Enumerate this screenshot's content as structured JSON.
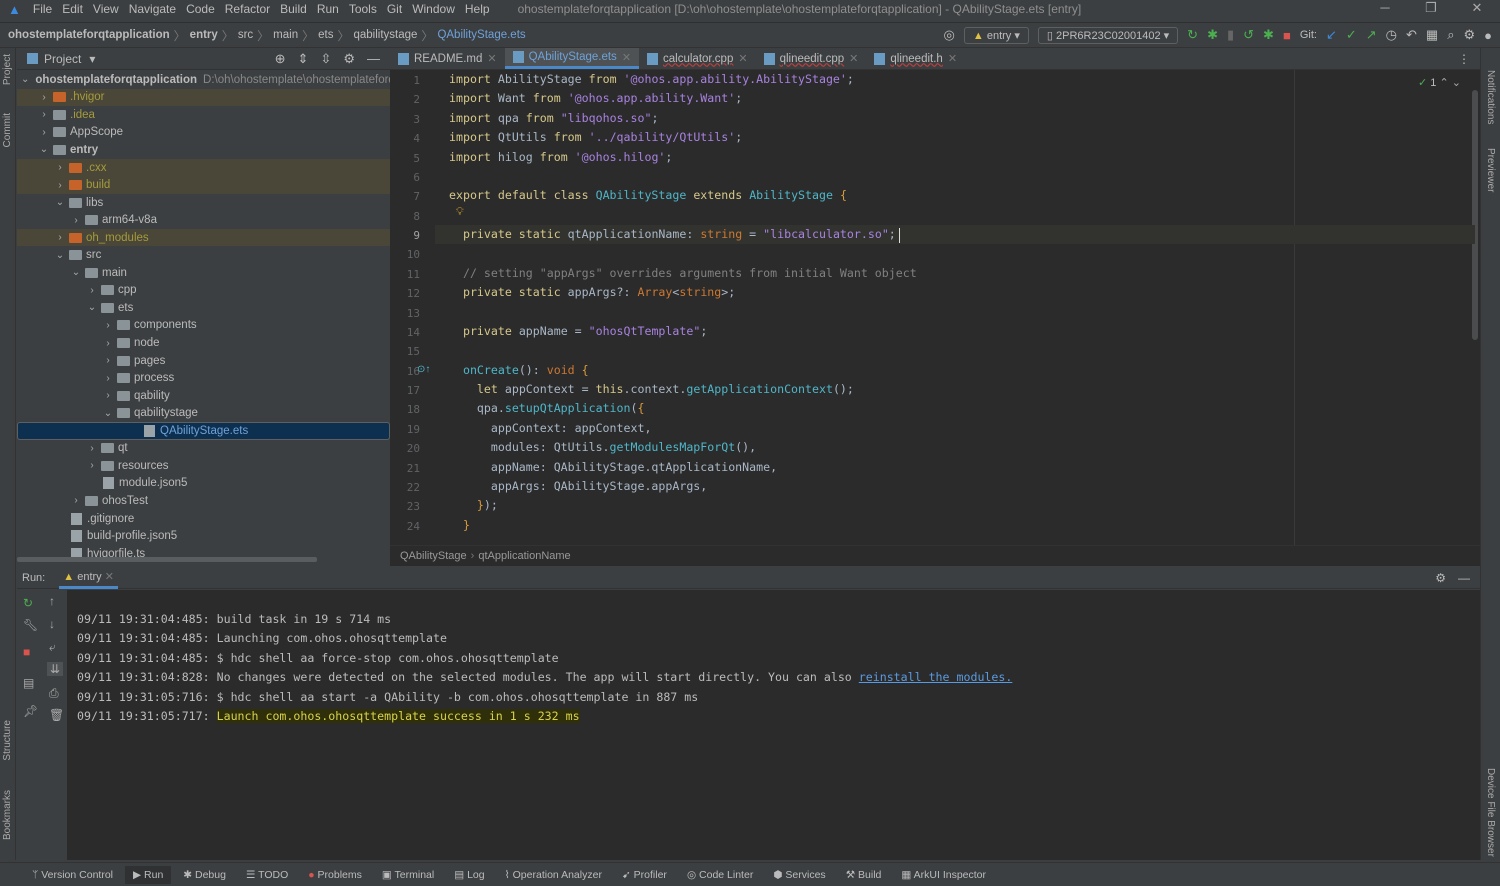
{
  "menubar": {
    "items": [
      "File",
      "Edit",
      "View",
      "Navigate",
      "Code",
      "Refactor",
      "Build",
      "Run",
      "Tools",
      "Git",
      "Window",
      "Help"
    ],
    "title": "ohostemplateforqtapplication [D:\\oh\\ohostemplate\\ohostemplateforqtapplication] - QAbilityStage.ets [entry]"
  },
  "breadcrumb": [
    "ohostemplateforqtapplication",
    "entry",
    "src",
    "main",
    "ets",
    "qabilitystage",
    "QAbilityStage.ets"
  ],
  "toolbar": {
    "run_config": "entry",
    "device": "2PR6R23C02001402",
    "git_label": "Git:"
  },
  "sidestrip": {
    "left": [
      "Project",
      "Commit",
      "Structure",
      "Bookmarks"
    ],
    "right": [
      "Notifications",
      "Previewer",
      "Device File Browser"
    ]
  },
  "project": {
    "title": "Project",
    "root_path": "D:\\oh\\ohostemplate\\ohostemplateforqtapplication",
    "tree": [
      {
        "name": "ohostemplateforqtapplication",
        "d": 0,
        "a": "open",
        "t": "mod",
        "bold": true
      },
      {
        "name": ".hvigor",
        "d": 1,
        "a": "closed",
        "t": "orange",
        "exc": true
      },
      {
        "name": ".idea",
        "d": 1,
        "a": "closed",
        "t": "folder",
        "olive": true
      },
      {
        "name": "AppScope",
        "d": 1,
        "a": "closed",
        "t": "folder"
      },
      {
        "name": "entry",
        "d": 1,
        "a": "open",
        "t": "mod",
        "bold": true
      },
      {
        "name": ".cxx",
        "d": 2,
        "a": "closed",
        "t": "orange",
        "exc": true
      },
      {
        "name": "build",
        "d": 2,
        "a": "closed",
        "t": "orange",
        "exc": true
      },
      {
        "name": "libs",
        "d": 2,
        "a": "open",
        "t": "folder"
      },
      {
        "name": "arm64-v8a",
        "d": 3,
        "a": "closed",
        "t": "folder"
      },
      {
        "name": "oh_modules",
        "d": 2,
        "a": "closed",
        "t": "orange",
        "exc": true
      },
      {
        "name": "src",
        "d": 2,
        "a": "open",
        "t": "folder"
      },
      {
        "name": "main",
        "d": 3,
        "a": "open",
        "t": "folder"
      },
      {
        "name": "cpp",
        "d": 4,
        "a": "closed",
        "t": "folder"
      },
      {
        "name": "ets",
        "d": 4,
        "a": "open",
        "t": "folder"
      },
      {
        "name": "components",
        "d": 5,
        "a": "closed",
        "t": "folder"
      },
      {
        "name": "node",
        "d": 5,
        "a": "closed",
        "t": "folder"
      },
      {
        "name": "pages",
        "d": 5,
        "a": "closed",
        "t": "folder"
      },
      {
        "name": "process",
        "d": 5,
        "a": "closed",
        "t": "folder"
      },
      {
        "name": "qability",
        "d": 5,
        "a": "closed",
        "t": "folder"
      },
      {
        "name": "qabilitystage",
        "d": 5,
        "a": "open",
        "t": "folder"
      },
      {
        "name": "QAbilityStage.ets",
        "d": 6,
        "a": "none",
        "t": "file",
        "sel": true
      },
      {
        "name": "qt",
        "d": 4,
        "a": "closed",
        "t": "folder"
      },
      {
        "name": "resources",
        "d": 4,
        "a": "closed",
        "t": "folder"
      },
      {
        "name": "module.json5",
        "d": 4,
        "a": "none",
        "t": "file"
      },
      {
        "name": "ohosTest",
        "d": 3,
        "a": "closed",
        "t": "folder"
      },
      {
        "name": ".gitignore",
        "d": 2,
        "a": "none",
        "t": "file"
      },
      {
        "name": "build-profile.json5",
        "d": 2,
        "a": "none",
        "t": "file"
      },
      {
        "name": "hvigorfile.ts",
        "d": 2,
        "a": "none",
        "t": "file"
      }
    ]
  },
  "tabs": [
    {
      "label": "README.md",
      "active": false,
      "err": false
    },
    {
      "label": "QAbilityStage.ets",
      "active": true,
      "err": false
    },
    {
      "label": "calculator.cpp",
      "active": false,
      "err": true
    },
    {
      "label": "qlineedit.cpp",
      "active": false,
      "err": true
    },
    {
      "label": "qlineedit.h",
      "active": false,
      "err": true
    }
  ],
  "editor": {
    "inspection_count": "1",
    "current_line": 9,
    "lines": [
      [
        [
          "import",
          "kw"
        ],
        " AbilityStage ",
        [
          "from",
          "kw"
        ],
        " ",
        [
          "'@ohos.app.ability.AbilityStage'",
          "str"
        ],
        ";"
      ],
      [
        [
          "import",
          "kw"
        ],
        " Want ",
        [
          "from",
          "kw"
        ],
        " ",
        [
          "'@ohos.app.ability.Want'",
          "str"
        ],
        ";"
      ],
      [
        [
          "import",
          "kw"
        ],
        " qpa ",
        [
          "from",
          "kw"
        ],
        " ",
        [
          "\"libqohos.so\"",
          "str"
        ],
        ";"
      ],
      [
        [
          "import",
          "kw"
        ],
        " QtUtils ",
        [
          "from",
          "kw"
        ],
        " ",
        [
          "'../qability/QtUtils'",
          "str"
        ],
        ";"
      ],
      [
        [
          "import",
          "kw"
        ],
        " hilog ",
        [
          "from",
          "kw"
        ],
        " ",
        [
          "'@ohos.hilog'",
          "str"
        ],
        ";"
      ],
      [],
      [
        [
          "export default class",
          "kw"
        ],
        " ",
        [
          "QAbilityStage",
          "cls"
        ],
        " ",
        [
          "extends",
          "kw"
        ],
        " ",
        [
          "AbilityStage",
          "cls"
        ],
        " ",
        [
          "{",
          "br"
        ]
      ],
      [],
      [
        "  ",
        [
          "private static",
          "kw"
        ],
        " qtApplicationName: ",
        [
          "string",
          "typ"
        ],
        " = ",
        [
          "\"libcalculator.so\"",
          "str"
        ],
        ";"
      ],
      [],
      [
        "  ",
        [
          "// setting \"appArgs\" overrides arguments from initial Want object",
          "cmt"
        ]
      ],
      [
        "  ",
        [
          "private static",
          "kw"
        ],
        " appArgs?: ",
        [
          "Array",
          "typ"
        ],
        "<",
        [
          "string",
          "typ"
        ],
        ">;"
      ],
      [],
      [
        "  ",
        [
          "private",
          "kw"
        ],
        " appName = ",
        [
          "\"ohosQtTemplate\"",
          "str"
        ],
        ";"
      ],
      [],
      [
        "  ",
        [
          "onCreate",
          "fn"
        ],
        "(): ",
        [
          "void",
          "typ"
        ],
        " ",
        [
          "{",
          "br"
        ]
      ],
      [
        "    ",
        [
          "let",
          "kw"
        ],
        " appContext = ",
        [
          "this",
          "kw"
        ],
        ".context.",
        [
          "getApplicationContext",
          "fn"
        ],
        "();"
      ],
      [
        "    qpa.",
        [
          "setupQtApplication",
          "fn"
        ],
        "(",
        [
          "{",
          "br"
        ]
      ],
      [
        "      appContext: appContext,"
      ],
      [
        "      modules: QtUtils.",
        [
          "getModulesMapForQt",
          "fn"
        ],
        "(),"
      ],
      [
        "      appName: QAbilityStage.qtApplicationName,"
      ],
      [
        "      appArgs: QAbilityStage.appArgs,"
      ],
      [
        "    ",
        [
          "}",
          "br"
        ],
        ");"
      ],
      [
        "  ",
        [
          "}",
          "br"
        ]
      ]
    ]
  },
  "editor_breadcrumb": [
    "QAbilityStage",
    "qtApplicationName"
  ],
  "run": {
    "label": "Run:",
    "tab": "entry",
    "lines": [
      {
        "time": "09/11 19:31:04:485: ",
        "msg": "build task in 19 s 714 ms"
      },
      {
        "time": "09/11 19:31:04:485: ",
        "msg": "Launching com.ohos.ohosqttemplate"
      },
      {
        "time": "09/11 19:31:04:485: ",
        "msg": "$ hdc shell aa force-stop com.ohos.ohosqttemplate"
      },
      {
        "time": "09/11 19:31:04:828: ",
        "msg": "No changes were detected on the selected modules. The app will start directly. You can also ",
        "link": "reinstall the modules."
      },
      {
        "time": "09/11 19:31:05:716: ",
        "msg": "$ hdc shell aa start -a QAbility -b com.ohos.ohosqttemplate in 887 ms"
      },
      {
        "time": "09/11 19:31:05:717: ",
        "msg": "Launch com.ohos.ohosqttemplate success in 1 s 232 ms",
        "success": true
      }
    ]
  },
  "bottombar": [
    {
      "label": "Version Control",
      "icon": "branch-icon"
    },
    {
      "label": "Run",
      "icon": "run-icon",
      "active": true
    },
    {
      "label": "Debug",
      "icon": "bug-icon"
    },
    {
      "label": "TODO",
      "icon": "list-icon"
    },
    {
      "label": "Problems",
      "icon": "error-icon"
    },
    {
      "label": "Terminal",
      "icon": "terminal-icon"
    },
    {
      "label": "Log",
      "icon": "log-icon"
    },
    {
      "label": "Operation Analyzer",
      "icon": "chart-icon"
    },
    {
      "label": "Profiler",
      "icon": "profiler-icon"
    },
    {
      "label": "Code Linter",
      "icon": "linter-icon"
    },
    {
      "label": "Services",
      "icon": "services-icon"
    },
    {
      "label": "Build",
      "icon": "hammer-icon"
    },
    {
      "label": "ArkUI Inspector",
      "icon": "inspector-icon"
    }
  ],
  "colors": {
    "accent": "#4a88c7",
    "success": "#d8d24b",
    "link": "#5a9ae0",
    "editor_bg": "#2b2b2b",
    "panel_bg": "#3c3f41"
  }
}
